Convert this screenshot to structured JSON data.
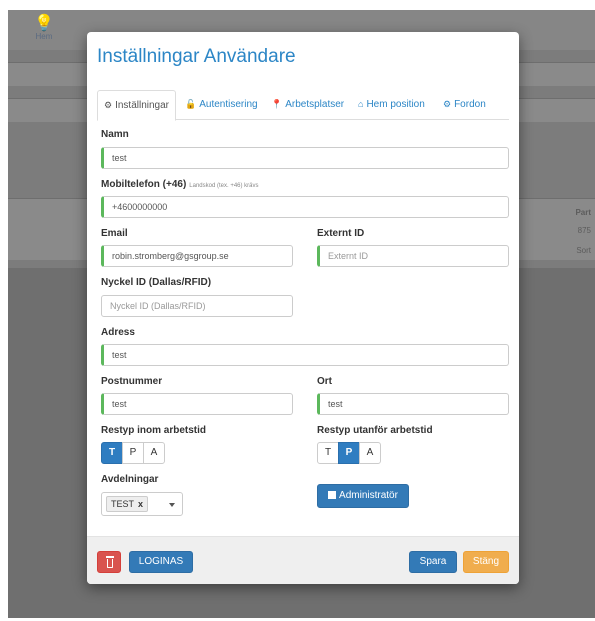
{
  "background": {
    "home_label": "Hem",
    "right_column_header": "Part",
    "right_column_rows": [
      "875",
      "Sort"
    ]
  },
  "modal": {
    "title": "Inställningar Användare",
    "tabs": [
      {
        "label": "Inställningar",
        "icon": "gear-icon",
        "glyph": "⚙",
        "active": true
      },
      {
        "label": "Autentisering",
        "icon": "lock-icon",
        "glyph": "🔓",
        "active": false
      },
      {
        "label": "Arbetsplatser",
        "icon": "map-marker-icon",
        "glyph": "📍",
        "active": false
      },
      {
        "label": "Hem position",
        "icon": "home-icon",
        "glyph": "⌂",
        "active": false
      },
      {
        "label": "Fordon",
        "icon": "gears-icon",
        "glyph": "⚙",
        "active": false
      }
    ],
    "fields": {
      "name": {
        "label": "Namn",
        "value": "test"
      },
      "mobile": {
        "label": "Mobiltelefon (+46)",
        "hint": "Landskod (tex. +46) krävs",
        "value": "+4600000000"
      },
      "email": {
        "label": "Email",
        "value": "robin.stromberg@gsgroup.se"
      },
      "external_id": {
        "label": "Externt ID",
        "value": "",
        "placeholder": "Externt ID"
      },
      "key_id": {
        "label": "Nyckel ID (Dallas/RFID)",
        "value": "",
        "placeholder": "Nyckel ID (Dallas/RFID)"
      },
      "address": {
        "label": "Adress",
        "value": "test"
      },
      "postcode": {
        "label": "Postnummer",
        "value": "test"
      },
      "city": {
        "label": "Ort",
        "value": "test"
      }
    },
    "trip_type_work": {
      "label": "Restyp inom arbetstid",
      "options": [
        "T",
        "P",
        "A"
      ],
      "selected": "T"
    },
    "trip_type_off": {
      "label": "Restyp utanför arbetstid",
      "options": [
        "T",
        "P",
        "A"
      ],
      "selected": "P"
    },
    "departments": {
      "label": "Avdelningar",
      "tokens": [
        "TEST"
      ],
      "remove_glyph": "x"
    },
    "admin_toggle": {
      "label": "Administratör",
      "checked": false
    },
    "footer": {
      "delete_icon": "trash-icon",
      "login_label": "LOGINAS",
      "save_label": "Spara",
      "close_label": "Stäng"
    },
    "colors": {
      "accent": "#2c86c6",
      "primary": "#337ab7",
      "danger": "#d9534f",
      "warning": "#f0ad4e",
      "valid": "#5cb85c"
    }
  }
}
